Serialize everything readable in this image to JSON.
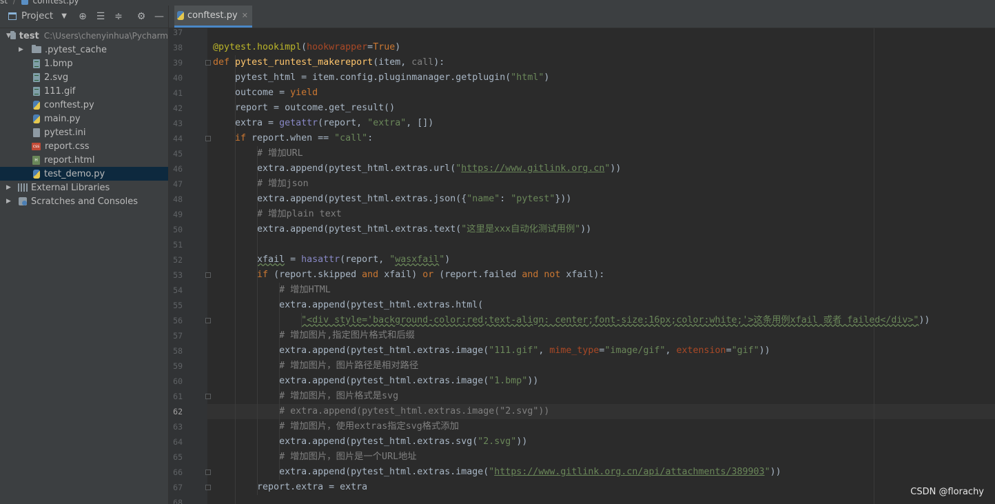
{
  "breadcrumb": {
    "project": "st",
    "file": "conftest.py"
  },
  "sidebar": {
    "title": "Project",
    "root": {
      "name": "test",
      "path": "C:\\Users\\chenyinhua\\Pycharm"
    },
    "items": [
      {
        "label": ".pytest_cache",
        "icon": "folder-icon"
      },
      {
        "label": "1.bmp",
        "icon": "image-file-icon"
      },
      {
        "label": "2.svg",
        "icon": "image-file-icon"
      },
      {
        "label": "111.gif",
        "icon": "image-file-icon"
      },
      {
        "label": "conftest.py",
        "icon": "python-file-icon"
      },
      {
        "label": "main.py",
        "icon": "python-file-icon"
      },
      {
        "label": "pytest.ini",
        "icon": "ini-file-icon"
      },
      {
        "label": "report.css",
        "icon": "css-file-icon"
      },
      {
        "label": "report.html",
        "icon": "html-file-icon"
      },
      {
        "label": "test_demo.py",
        "icon": "python-file-icon"
      }
    ],
    "external_libraries": "External Libraries",
    "scratches": "Scratches and Consoles"
  },
  "tabs": [
    {
      "label": "conftest.py",
      "active": true
    }
  ],
  "editor": {
    "current_line": 62,
    "lines": [
      {
        "n": "37",
        "html": ""
      },
      {
        "n": "38",
        "html": "<span class=\"d\">@pytest.hookimpl</span>(<span class=\"p\">hookwrapper</span>=<span class=\"k\">True</span>)"
      },
      {
        "n": "39",
        "html": "<span class=\"k\">def</span> <span class=\"f\">pytest_runtest_makereport</span>(item, <span class=\"c\">call</span>):"
      },
      {
        "n": "40",
        "html": "    pytest_html = item.config.pluginmanager.getplugin(<span class=\"s\">\"html\"</span>)"
      },
      {
        "n": "41",
        "html": "    outcome = <span class=\"k\">yield</span>"
      },
      {
        "n": "42",
        "html": "    report = outcome.get_result()"
      },
      {
        "n": "43",
        "html": "    extra = <span class=\"b\">getattr</span>(report, <span class=\"s\">\"extra\"</span>, [])"
      },
      {
        "n": "44",
        "html": "    <span class=\"k\">if</span> report.when == <span class=\"s\">\"call\"</span>:"
      },
      {
        "n": "45",
        "html": "        <span class=\"c\"># 增加URL</span>"
      },
      {
        "n": "46",
        "html": "        extra.append(pytest_html.extras.url(<span class=\"s\">\"<span class=\"u\">https://www.gitlink.org.cn</span>\"</span>))"
      },
      {
        "n": "47",
        "html": "        <span class=\"c\"># 增加json</span>"
      },
      {
        "n": "48",
        "html": "        extra.append(pytest_html.extras.json({<span class=\"s\">\"name\"</span>: <span class=\"s\">\"pytest\"</span>}))"
      },
      {
        "n": "49",
        "html": "        <span class=\"c\"># 增加plain text</span>"
      },
      {
        "n": "50",
        "html": "        extra.append(pytest_html.extras.text(<span class=\"s\">\"这里是xxx自动化测试用例\"</span>))"
      },
      {
        "n": "51",
        "html": ""
      },
      {
        "n": "52",
        "html": "        <span class=\"w\">xfail</span> = <span class=\"b\">hasattr</span>(report, <span class=\"s\">\"<span class=\"w\">wasxfail</span>\"</span>)"
      },
      {
        "n": "53",
        "html": "        <span class=\"k\">if</span> (report.skipped <span class=\"k\">and</span> xfail) <span class=\"k\">or</span> (report.failed <span class=\"k\">and not</span> xfail):"
      },
      {
        "n": "54",
        "html": "            <span class=\"c\"># 增加HTML</span>"
      },
      {
        "n": "55",
        "html": "            extra.append(pytest_html.extras.html("
      },
      {
        "n": "56",
        "html": "                <span class=\"s w\">\"&lt;div style='background-color:red;text-align: center;font-size:16px;color:white;'&gt;这条用例xfail 或者 failed&lt;/div&gt;\"</span>))"
      },
      {
        "n": "57",
        "html": "            <span class=\"c\"># 增加图片,指定图片格式和后缀</span>"
      },
      {
        "n": "58",
        "html": "            extra.append(pytest_html.extras.image(<span class=\"s\">\"111.gif\"</span>, <span class=\"p\">mime_type</span>=<span class=\"s\">\"image/gif\"</span>, <span class=\"p\">extension</span>=<span class=\"s\">\"gif\"</span>))"
      },
      {
        "n": "59",
        "html": "            <span class=\"c\"># 增加图片，图片路径是相对路径</span>"
      },
      {
        "n": "60",
        "html": "            extra.append(pytest_html.extras.image(<span class=\"s\">\"1.bmp\"</span>))"
      },
      {
        "n": "61",
        "html": "            <span class=\"c\"># 增加图片，图片格式是svg</span>"
      },
      {
        "n": "62",
        "html": "            <span class=\"c\"># extra.append(pytest_html.extras.image(\"2.svg\"))</span>"
      },
      {
        "n": "63",
        "html": "            <span class=\"c\"># 增加图片，使用extras指定svg格式添加</span>"
      },
      {
        "n": "64",
        "html": "            extra.append(pytest_html.extras.svg(<span class=\"s\">\"2.svg\"</span>))"
      },
      {
        "n": "65",
        "html": "            <span class=\"c\"># 增加图片，图片是一个URL地址</span>"
      },
      {
        "n": "66",
        "html": "            extra.append(pytest_html.extras.image(<span class=\"s\">\"<span class=\"u\">https://www.gitlink.org.cn/api/attachments/389903</span>\"</span>))"
      },
      {
        "n": "67",
        "html": "        report.extra = extra"
      },
      {
        "n": "68",
        "html": ""
      }
    ]
  },
  "watermark": "CSDN @florachy"
}
